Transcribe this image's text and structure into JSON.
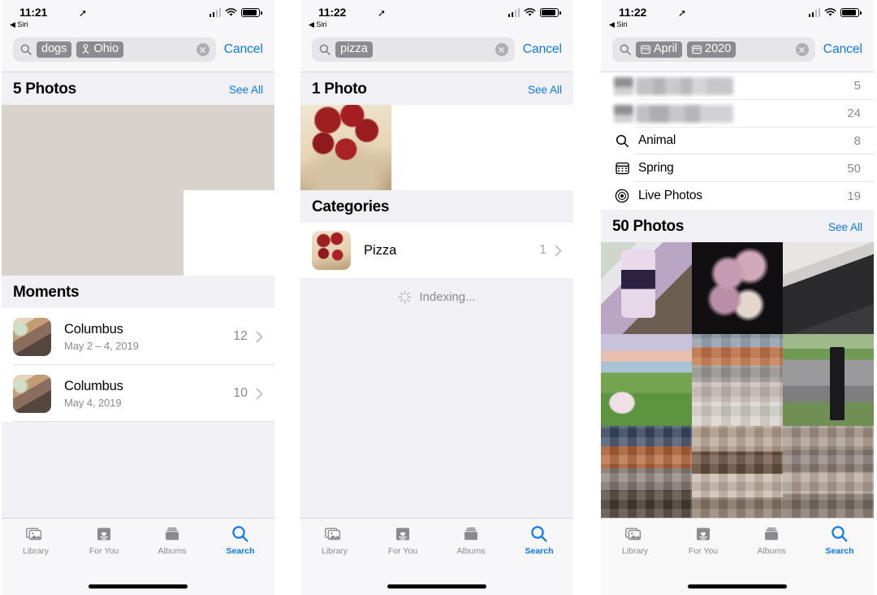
{
  "panels": [
    {
      "status": {
        "time": "11:21",
        "back_label": "Siri",
        "location_icon": "location-arrow-icon"
      },
      "search": {
        "tokens": [
          {
            "label": "dogs",
            "icon": null
          },
          {
            "label": "Ohio",
            "icon": "location-pin-icon"
          }
        ],
        "clear_label": "clear-icon",
        "cancel_label": "Cancel"
      },
      "photos_section": {
        "title": "5 Photos",
        "see_all": "See All",
        "count": 5
      },
      "moments_section": {
        "title": "Moments",
        "rows": [
          {
            "title": "Columbus",
            "subtitle": "May 2 – 4, 2019",
            "count": "12"
          },
          {
            "title": "Columbus",
            "subtitle": "May 4, 2019",
            "count": "10"
          }
        ]
      },
      "tabs": [
        {
          "label": "Library",
          "icon": "photos-library-icon",
          "active": false
        },
        {
          "label": "For You",
          "icon": "for-you-icon",
          "active": false
        },
        {
          "label": "Albums",
          "icon": "albums-icon",
          "active": false
        },
        {
          "label": "Search",
          "icon": "search-icon",
          "active": true
        }
      ]
    },
    {
      "status": {
        "time": "11:22",
        "back_label": "Siri",
        "location_icon": "location-arrow-icon"
      },
      "search": {
        "tokens": [
          {
            "label": "pizza",
            "icon": null
          }
        ],
        "clear_label": "clear-icon",
        "cancel_label": "Cancel"
      },
      "photos_section": {
        "title": "1 Photo",
        "see_all": "See All",
        "count": 1
      },
      "categories_section": {
        "title": "Categories",
        "rows": [
          {
            "title": "Pizza",
            "count": "1"
          }
        ]
      },
      "indexing": {
        "label": "Indexing...",
        "icon": "spinner-icon"
      },
      "tabs": [
        {
          "label": "Library",
          "icon": "photos-library-icon",
          "active": false
        },
        {
          "label": "For You",
          "icon": "for-you-icon",
          "active": false
        },
        {
          "label": "Albums",
          "icon": "albums-icon",
          "active": false
        },
        {
          "label": "Search",
          "icon": "search-icon",
          "active": true
        }
      ]
    },
    {
      "status": {
        "time": "11:22",
        "back_label": "Siri",
        "location_icon": "location-arrow-icon"
      },
      "search": {
        "tokens": [
          {
            "label": "April",
            "icon": "calendar-icon"
          },
          {
            "label": "2020",
            "icon": "calendar-icon"
          }
        ],
        "clear_label": "clear-icon",
        "cancel_label": "Cancel"
      },
      "suggestions": [
        {
          "label": "",
          "redacted": true,
          "count": "5",
          "icon": "redacted-icon"
        },
        {
          "label": "",
          "redacted": true,
          "count": "24",
          "icon": "redacted-icon"
        },
        {
          "label": "Animal",
          "redacted": false,
          "count": "8",
          "icon": "search-icon"
        },
        {
          "label": "Spring",
          "redacted": false,
          "count": "50",
          "icon": "calendar-icon"
        },
        {
          "label": "Live Photos",
          "redacted": false,
          "count": "19",
          "icon": "live-photo-icon"
        }
      ],
      "photos_section": {
        "title": "50 Photos",
        "see_all": "See All",
        "count": 50
      },
      "tabs": [
        {
          "label": "Library",
          "icon": "photos-library-icon",
          "active": false
        },
        {
          "label": "For You",
          "icon": "for-you-icon",
          "active": false
        },
        {
          "label": "Albums",
          "icon": "albums-icon",
          "active": false
        },
        {
          "label": "Search",
          "icon": "search-icon",
          "active": true
        }
      ]
    }
  ],
  "colors": {
    "accent_blue": "#0a78ff",
    "token_gray": "#8b8b91",
    "field_gray": "#e6e6ea",
    "section_gray": "#f1f1f5",
    "secondary_text": "#8a8a8e"
  }
}
